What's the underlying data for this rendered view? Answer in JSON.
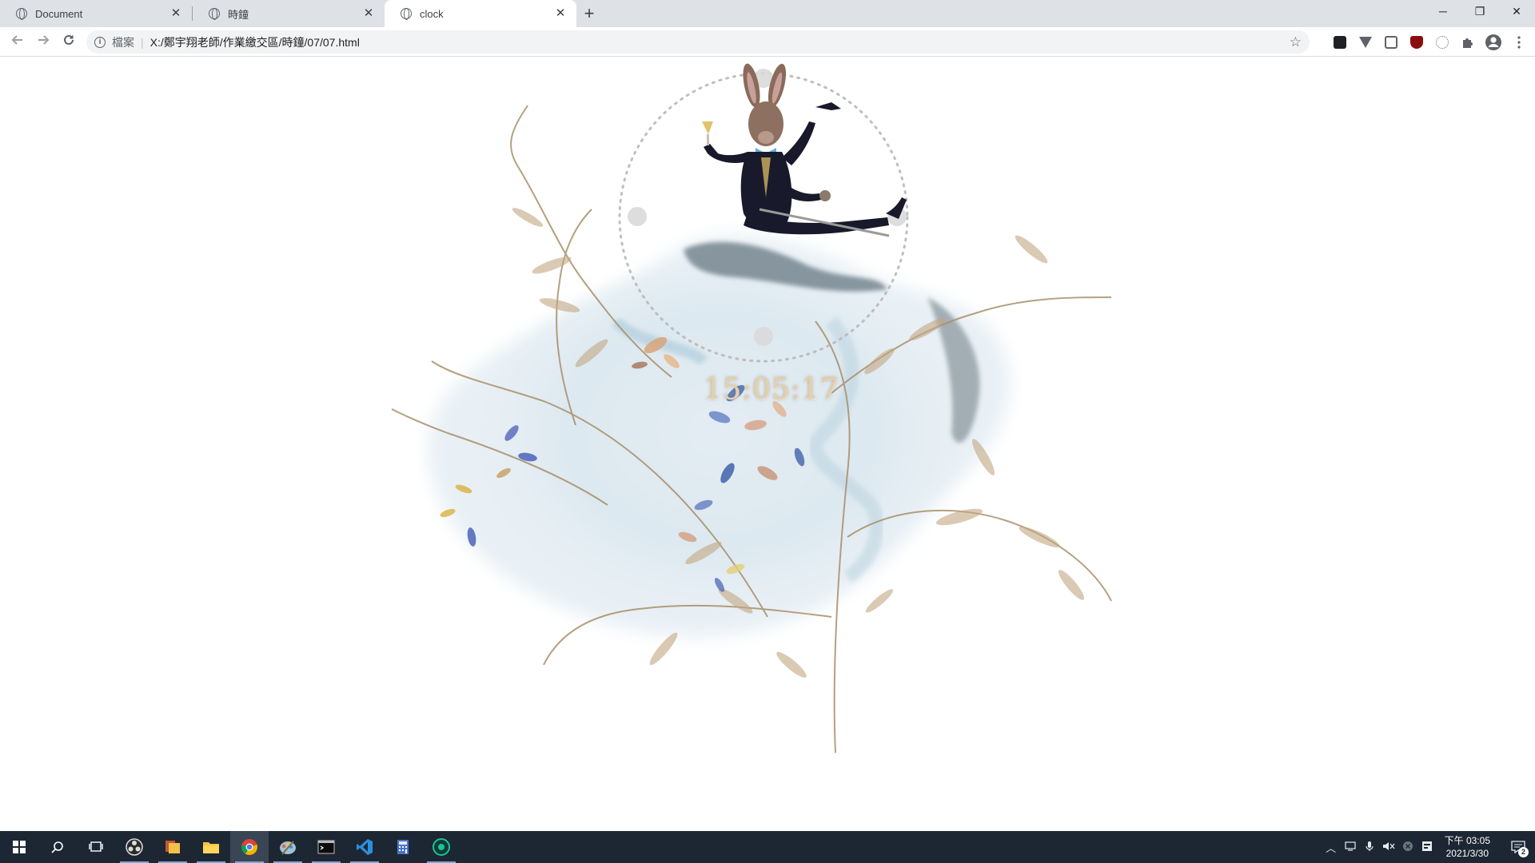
{
  "browser": {
    "tabs": [
      {
        "title": "Document",
        "active": false
      },
      {
        "title": "時鐘",
        "active": false
      },
      {
        "title": "clock",
        "active": true
      }
    ],
    "new_tab": "+",
    "address": {
      "scheme_label": "檔案",
      "url": "X:/鄭宇翔老師/作業繳交區/時鐘/07/07.html"
    },
    "window_controls": {
      "minimize": "─",
      "restore": "❐",
      "close": "✕"
    }
  },
  "page": {
    "clock_time": "15:05:17"
  },
  "taskbar": {
    "clock": {
      "time": "下午 03:05",
      "date": "2021/3/30"
    },
    "notification_count": "2",
    "colors": {
      "background": "#1d2733",
      "accent": "#7aa6d6"
    }
  }
}
